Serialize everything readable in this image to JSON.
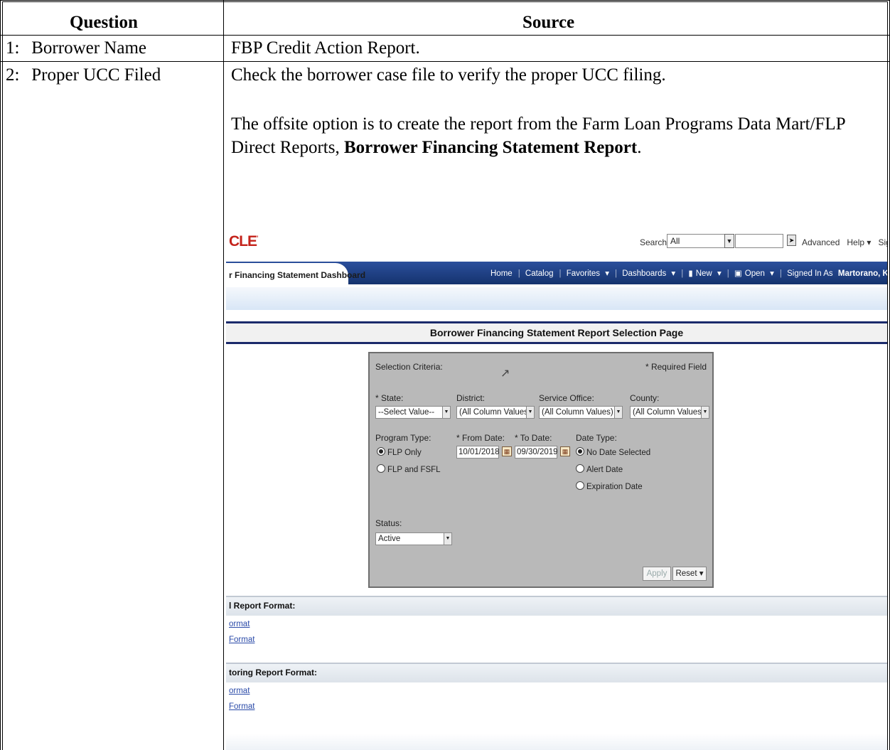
{
  "table": {
    "headers": {
      "question": "Question",
      "source": "Source"
    },
    "rows": [
      {
        "number": "1:",
        "question": "Borrower Name",
        "source": "FBP Credit Action Report."
      },
      {
        "number": "2:",
        "question": "Proper UCC Filed",
        "source_line1": "Check the borrower case file to verify the proper UCC filing.",
        "source_para_intro": "The offsite option is to create the report from the Farm Loan Programs Data Mart/FLP Direct Reports, ",
        "source_para_bold": "Borrower Financing Statement Report",
        "source_para_end": "."
      }
    ]
  },
  "screenshot": {
    "logo": "CLE",
    "search_label": "Search",
    "search_scope": "All",
    "advanced": "Advanced",
    "help": "Help",
    "signout": "Sig",
    "dashboard_tab": "r Financing Statement Dashboard",
    "nav": {
      "home": "Home",
      "catalog": "Catalog",
      "favorites": "Favorites",
      "dashboards": "Dashboards",
      "new": "New",
      "open": "Open",
      "signed_in_as": "Signed In As",
      "user": "Martorano, Kristina - FSA, Washingto"
    },
    "page_title": "Borrower Financing Statement Report Selection Page",
    "selection": {
      "heading": "Selection Criteria:",
      "required": "* Required Field",
      "state_label": "* State:",
      "state_value": "--Select Value--",
      "district_label": "District:",
      "district_value": "(All Column Values)",
      "service_office_label": "Service Office:",
      "service_office_value": "(All Column Values)",
      "county_label": "County:",
      "county_value": "(All Column Values)",
      "program_type_label": "Program Type:",
      "program_opt1": "FLP Only",
      "program_opt2": "FLP and FSFL",
      "from_date_label": "* From Date:",
      "from_date_value": "10/01/2018",
      "to_date_label": "* To Date:",
      "to_date_value": "09/30/2019",
      "date_type_label": "Date Type:",
      "date_opt1": "No Date Selected",
      "date_opt2": "Alert Date",
      "date_opt3": "Expiration Date",
      "status_label": "Status:",
      "status_value": "Active",
      "apply": "Apply",
      "reset": "Reset"
    },
    "section1": {
      "title": "l Report Format:",
      "link1": "ormat",
      "link2": "Format"
    },
    "section2": {
      "title": "toring Report Format:",
      "link1": "ormat",
      "link2": "Format"
    }
  }
}
